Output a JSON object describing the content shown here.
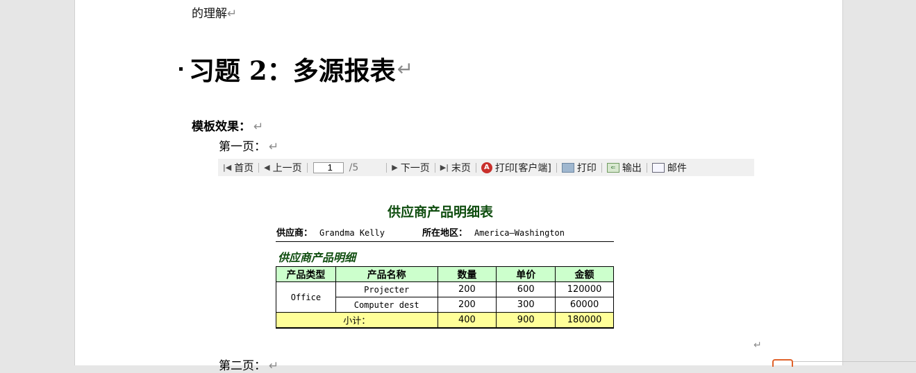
{
  "document": {
    "top_line": "的理解",
    "heading": "习题 2：多源报表",
    "template_label": "模板效果：",
    "page1_label": "第一页：",
    "page2_label": "第二页：",
    "para_mark": "↵"
  },
  "toolbar": {
    "first": "首页",
    "prev": "上一页",
    "page_value": "1",
    "page_total": "/5",
    "next": "下一页",
    "last": "末页",
    "print_client": "打印[客户端]",
    "print": "打印",
    "export": "输出",
    "mail": "邮件",
    "icons": {
      "first": "first-page-icon",
      "prev": "prev-page-icon",
      "next": "next-page-icon",
      "last": "last-page-icon",
      "print_client": "pdf-print-icon",
      "print": "printer-icon",
      "export": "export-icon",
      "mail": "mail-icon"
    }
  },
  "report": {
    "title": "供应商产品明细表",
    "supplier_label": "供应商：",
    "supplier_value": "Grandma Kelly",
    "region_label": "所在地区：",
    "region_value": "America—Washington",
    "section_title": "供应商产品明细",
    "columns": [
      "产品类型",
      "产品名称",
      "数量",
      "单价",
      "金额"
    ],
    "category": "Office",
    "rows": [
      {
        "name": "Projecter",
        "qty": "200",
        "price": "600",
        "amount": "120000"
      },
      {
        "name": "Computer dest",
        "qty": "200",
        "price": "300",
        "amount": "60000"
      }
    ],
    "subtotal": {
      "label": "小计：",
      "qty": "400",
      "price": "900",
      "amount": "180000"
    },
    "colors": {
      "title": "#0f4d0f",
      "header_bg": "#ccffcc",
      "subtotal_bg": "#ffff99"
    }
  }
}
